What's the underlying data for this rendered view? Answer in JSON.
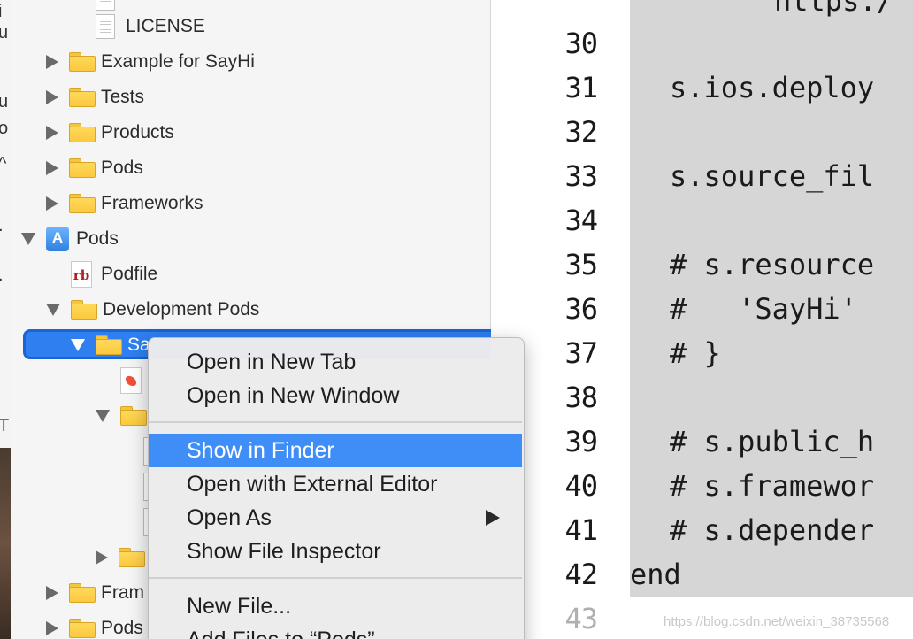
{
  "navigator": {
    "rows": [
      {
        "label": "LICENSE",
        "kind": "file"
      },
      {
        "label": "Example for SayHi",
        "kind": "folder"
      },
      {
        "label": "Tests",
        "kind": "folder"
      },
      {
        "label": "Products",
        "kind": "folder"
      },
      {
        "label": "Pods",
        "kind": "folder"
      },
      {
        "label": "Frameworks",
        "kind": "folder"
      },
      {
        "label": "Pods",
        "kind": "project"
      },
      {
        "label": "Podfile",
        "kind": "ruby-file"
      },
      {
        "label": "Development Pods",
        "kind": "folder"
      },
      {
        "label": "Sa",
        "kind": "folder",
        "selected": true
      },
      {
        "label": "Fram",
        "kind": "folder"
      },
      {
        "label": "Pods",
        "kind": "folder"
      }
    ],
    "rb_badge": "rb"
  },
  "context_menu": {
    "items": [
      "Open in New Tab",
      "Open in New Window",
      "Show in Finder",
      "Open with External Editor",
      "Open As",
      "Show File Inspector",
      "New File...",
      "Add Files to “Pods”"
    ],
    "highlighted": "Show in Finder"
  },
  "editor": {
    "top_partial": "https:/",
    "lines": [
      {
        "n": "30",
        "code": ""
      },
      {
        "n": "31",
        "code": "s.ios.deploy"
      },
      {
        "n": "32",
        "code": ""
      },
      {
        "n": "33",
        "code": "s.source_fil"
      },
      {
        "n": "34",
        "code": ""
      },
      {
        "n": "35",
        "code": "# s.resource"
      },
      {
        "n": "36",
        "code": "#   'SayHi'"
      },
      {
        "n": "37",
        "code": "# }"
      },
      {
        "n": "38",
        "code": ""
      },
      {
        "n": "39",
        "code": "# s.public_h"
      },
      {
        "n": "40",
        "code": "# s.framewor"
      },
      {
        "n": "41",
        "code": "# s.depender"
      },
      {
        "n": "42",
        "code": "end"
      },
      {
        "n": "43",
        "code": ""
      }
    ],
    "watermark": "https://blog.csdn.net/weixin_38735568"
  },
  "colors": {
    "selection": "#2f7ff0",
    "menu_highlight": "#3f8ef7",
    "code_background": "#d6d6d6"
  }
}
